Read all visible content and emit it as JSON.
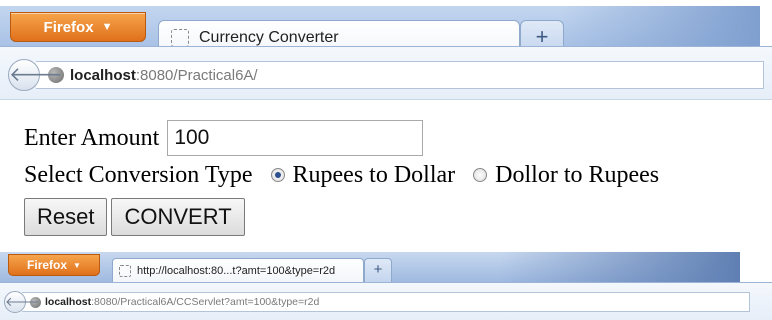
{
  "window1": {
    "firefox_label": "Firefox",
    "tab_title": "Currency Converter",
    "new_tab": "+",
    "url_host": "localhost",
    "url_rest": ":8080/Practical6A/"
  },
  "form": {
    "amount_label": "Enter Amount",
    "amount_value": "100",
    "conversion_label": "Select Conversion Type",
    "options": [
      {
        "label": "Rupees to Dollar",
        "selected": true
      },
      {
        "label": "Dollor to Rupees",
        "selected": false
      }
    ],
    "reset_label": "Reset",
    "convert_label": "CONVERT"
  },
  "window2": {
    "firefox_label": "Firefox",
    "tab_title": "http://localhost:80...t?amt=100&type=r2d",
    "new_tab": "+",
    "url_host": "localhost",
    "url_rest": ":8080/Practical6A/CCServlet?amt=100&type=r2d"
  },
  "colors": {
    "firefox_orange": "#e0701b",
    "tabbar_blue": "#a9c2e6",
    "radio_selected": "#2b4f8f"
  },
  "icons": [
    "chevron-down-icon",
    "blank-page-icon",
    "plus-icon",
    "back-arrow-icon",
    "globe-icon"
  ]
}
